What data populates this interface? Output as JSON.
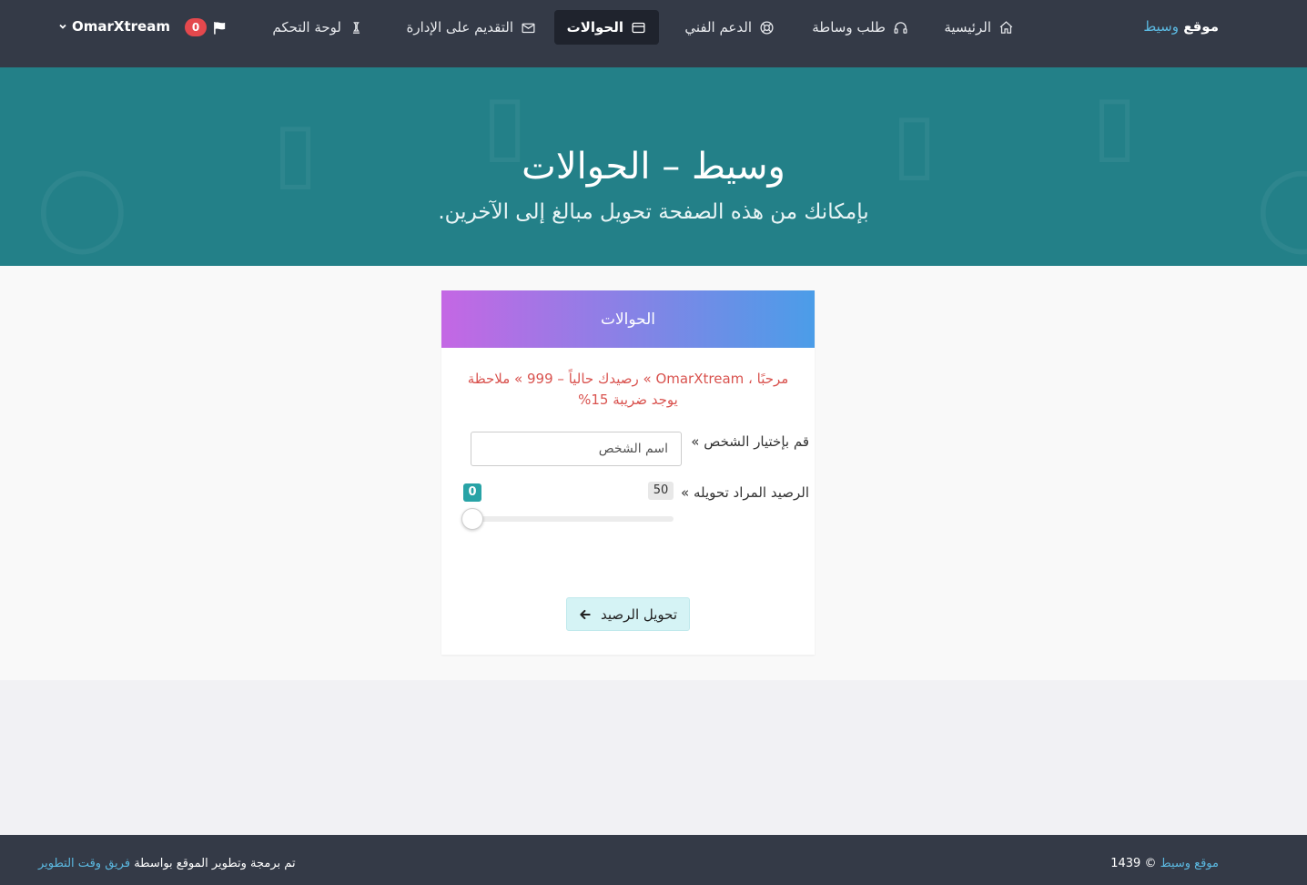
{
  "nav": {
    "brand_main": "موقع",
    "brand_accent": "وسيط",
    "items": [
      {
        "label": "الرئيسية",
        "icon": "home-icon"
      },
      {
        "label": "طلب وساطة",
        "icon": "headset-icon"
      },
      {
        "label": "الدعم الفني",
        "icon": "lifebuoy-icon"
      },
      {
        "label": "الحوالات",
        "icon": "credit-card-icon"
      },
      {
        "label": "التقديم على الإدارة",
        "icon": "envelope-icon"
      },
      {
        "label": "لوحة التحكم",
        "icon": "chess-icon"
      }
    ],
    "notifications_count": "0",
    "username": "OmarXtream"
  },
  "hero": {
    "title": "وسيط – الحوالات",
    "subtitle": "بإمكانك من هذه الصفحة تحويل مبالغ إلى الآخرين."
  },
  "card": {
    "header": "الحوالات",
    "notice": "مرحبًا ، OmarXtream » رصيدك حالياً – 999 » ملاحظة يوجد ضريبة 15%",
    "person_label": "قم بإختيار الشخص »",
    "person_placeholder": "اسم الشخص",
    "amount_label": "الرصيد المراد تحويله »",
    "slider_max": "50",
    "slider_value": "0",
    "slider_fraction": 0,
    "submit_label": "تحويل الرصيد"
  },
  "footer": {
    "left_prefix": "تم برمجة وتطوير الموقع بواسطة",
    "left_link": "فريق وقت التطوير",
    "right_link": "موقع وسيط",
    "right_suffix": "© 1439"
  },
  "colors": {
    "nav_bg": "#343a47",
    "hero_bg": "#238088",
    "accent": "#5bb8e0",
    "notice": "#d9534f",
    "gradient_start": "#c467e4",
    "gradient_end": "#4b9de8"
  }
}
